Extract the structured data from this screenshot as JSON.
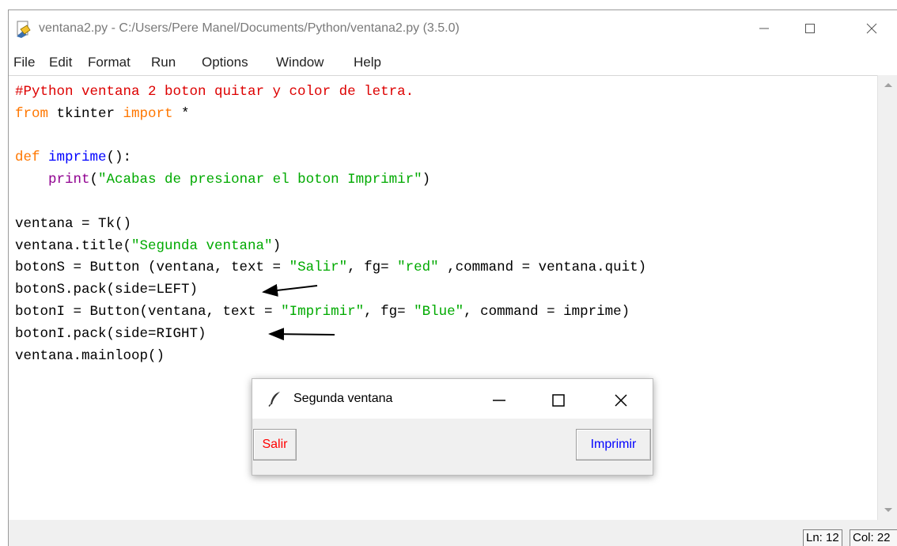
{
  "window": {
    "title": "ventana2.py - C:/Users/Pere Manel/Documents/Python/ventana2.py (3.5.0)",
    "controls": {
      "minimize_icon": "minimize-icon",
      "maximize_icon": "maximize-icon",
      "close_icon": "close-icon"
    }
  },
  "menu": [
    "File",
    "Edit",
    "Format",
    "Run",
    "Options",
    "Window",
    "Help"
  ],
  "editor": {
    "lines": [
      [
        {
          "t": "#Python ventana 2 boton quitar y color de letra.",
          "c": "cm"
        }
      ],
      [
        {
          "t": "from",
          "c": "kw"
        },
        {
          "t": " tkinter "
        },
        {
          "t": "import",
          "c": "kw"
        },
        {
          "t": " *"
        }
      ],
      [],
      [
        {
          "t": "def",
          "c": "kw"
        },
        {
          "t": " "
        },
        {
          "t": "imprime",
          "c": "df"
        },
        {
          "t": "():"
        }
      ],
      [
        {
          "t": "    "
        },
        {
          "t": "print",
          "c": "bi"
        },
        {
          "t": "("
        },
        {
          "t": "\"Acabas de presionar el boton Imprimir\"",
          "c": "st"
        },
        {
          "t": ")"
        }
      ],
      [],
      [
        {
          "t": "ventana = Tk()"
        }
      ],
      [
        {
          "t": "ventana.title("
        },
        {
          "t": "\"Segunda ventana\"",
          "c": "st"
        },
        {
          "t": ")"
        }
      ],
      [
        {
          "t": "botonS = Button (ventana, text = "
        },
        {
          "t": "\"Salir\"",
          "c": "st"
        },
        {
          "t": ", fg= "
        },
        {
          "t": "\"red\"",
          "c": "st"
        },
        {
          "t": " ,command = ventana.quit)"
        }
      ],
      [
        {
          "t": "botonS.pack(side=LEFT)"
        }
      ],
      [
        {
          "t": "botonI = Button(ventana, text = "
        },
        {
          "t": "\"Imprimir\"",
          "c": "st"
        },
        {
          "t": ", fg= "
        },
        {
          "t": "\"Blue\"",
          "c": "st"
        },
        {
          "t": ", command = imprime)"
        }
      ],
      [
        {
          "t": "botonI.pack(side=RIGHT)"
        }
      ],
      [
        {
          "t": "ventana.mainloop()"
        }
      ]
    ],
    "syntax_colors": {
      "keyword": "#ff7700",
      "comment": "#dd0000",
      "string": "#00aa00",
      "definition": "#0000ff",
      "builtin": "#900090"
    }
  },
  "status": {
    "line": "Ln: 12",
    "col": "Col: 22"
  },
  "tk_window": {
    "title": "Segunda ventana",
    "icon": "feather-icon",
    "buttons": [
      {
        "label": "Salir",
        "color": "#ff0000"
      },
      {
        "label": "Imprimir",
        "color": "#0000ff"
      }
    ]
  }
}
